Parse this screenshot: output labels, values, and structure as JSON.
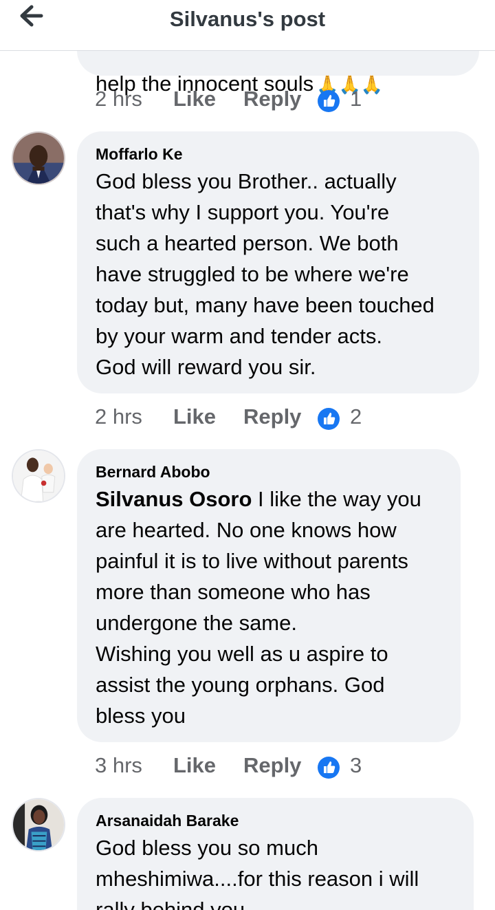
{
  "header": {
    "title": "Silvanus's post"
  },
  "colors": {
    "bubble": "#f0f2f5",
    "muted": "#65676b",
    "like_blue": "#1877f2"
  },
  "comments": [
    {
      "text": "help the innocent souls",
      "emojis": "🙏🙏🙏",
      "time": "2 hrs",
      "like": "Like",
      "reply": "Reply",
      "reactions": "1"
    },
    {
      "author": "Moffarlo Ke",
      "text": "God bless you Brother.. actually\nthat's why I support you. You're\nsuch a hearted person. We both\nhave struggled to be where we're\ntoday but, many have been touched\nby your warm and tender acts.\nGod will reward you sir.",
      "time": "2 hrs",
      "like": "Like",
      "reply": "Reply",
      "reactions": "2"
    },
    {
      "author": "Bernard Abobo",
      "mention": "Silvanus Osoro",
      "text": "I like the way you\nare hearted. No one knows how\npainful it is to live without parents\nmore than someone who has\nundergone the same.\nWishing you well as u aspire to\nassist the young orphans. God\nbless you",
      "time": "3 hrs",
      "like": "Like",
      "reply": "Reply",
      "reactions": "3"
    },
    {
      "author": "Arsanaidah Barake",
      "text": "God bless you so much\nmheshimiwa....for this reason i will\nrally behind you"
    }
  ]
}
